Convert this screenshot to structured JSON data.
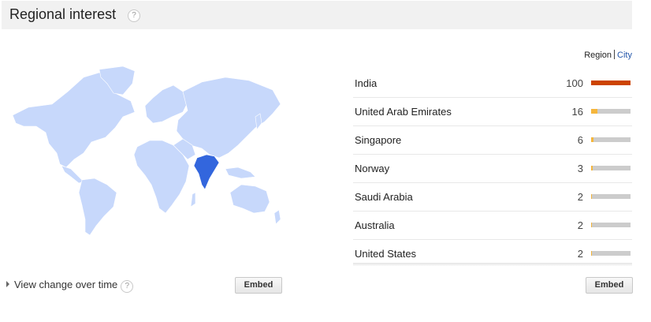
{
  "header": {
    "title": "Regional interest",
    "help": "?"
  },
  "toggle": {
    "region": "Region",
    "city": "City"
  },
  "rows": [
    {
      "name": "India",
      "value": "100",
      "level": 100,
      "color": "#cc4400"
    },
    {
      "name": "United Arab Emirates",
      "value": "16",
      "level": 16,
      "color": "#f5b63c"
    },
    {
      "name": "Singapore",
      "value": "6",
      "level": 6,
      "color": "#f5b63c"
    },
    {
      "name": "Norway",
      "value": "3",
      "level": 3,
      "color": "#f5b63c"
    },
    {
      "name": "Saudi Arabia",
      "value": "2",
      "level": 2,
      "color": "#f5b63c"
    },
    {
      "name": "Australia",
      "value": "2",
      "level": 2,
      "color": "#f5b63c"
    },
    {
      "name": "United States",
      "value": "2",
      "level": 2,
      "color": "#f5b63c"
    }
  ],
  "footer": {
    "view_change": "View change over time",
    "help": "?",
    "embed_left": "Embed",
    "embed_right": "Embed"
  },
  "map": {
    "land_color": "#c7d8fb",
    "highlight_color": "#3366dd",
    "highlighted_country": "India"
  }
}
